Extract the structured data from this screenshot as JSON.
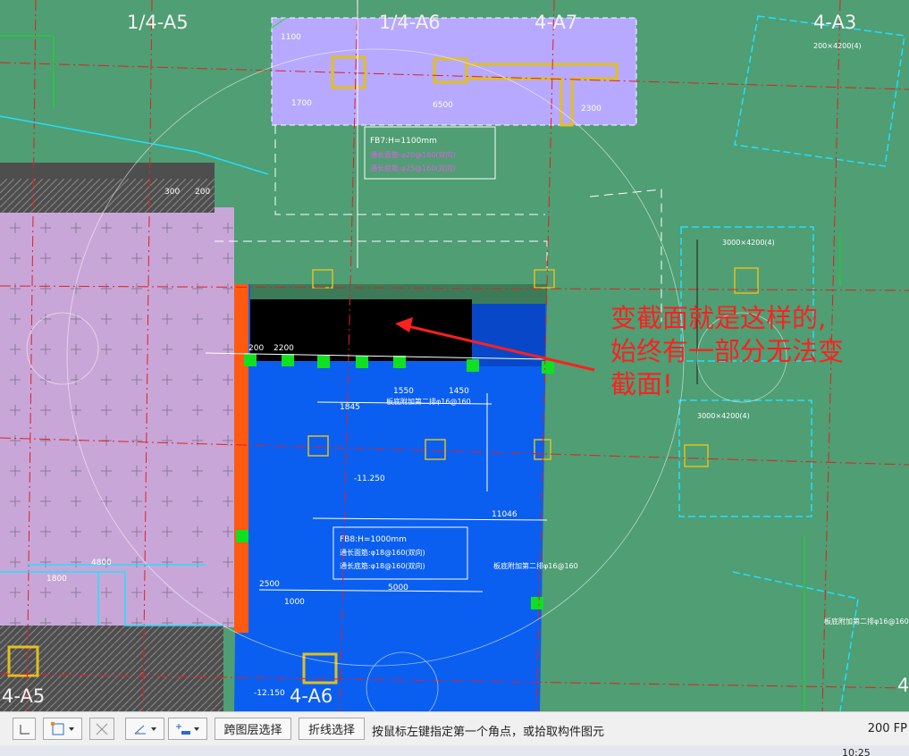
{
  "canvas": {
    "axis_labels": [
      "1/4-A5",
      "1/4-A6",
      "4-A7",
      "4-A3",
      "4-A5",
      "4-A6",
      "4"
    ],
    "cad_texts": {
      "beam_fb7": "FB7:H=1100mm",
      "fb7_line2": "通长面筋:φ20@160(双向)",
      "fb7_line3": "通长底筋:φ25@160(双向)",
      "beam_fb8": "FB8:H=1000mm",
      "fb8_line2": "通长面筋:φ18@160(双向)",
      "fb8_line3": "通长底筋:φ18@160(双向)",
      "dim_1550": "1550",
      "dim_1450": "1450",
      "dim_1845": "1845",
      "dim_11046": "11046",
      "dim_5000": "5000",
      "dim_2500": "2500",
      "dim_1000": "1000",
      "dim_4800": "4800",
      "dim_1800": "1800",
      "dim_200": "200",
      "dim_2200": "2200",
      "dim_1700": "1700",
      "dim_6500": "6500",
      "dim_2300": "2300",
      "dim_1100": "1100",
      "dim_300": "300",
      "dim_200b": "200",
      "elev_1": "-11.250",
      "elev_2": "-12.150",
      "slab_note_1": "板底附加第二排φ16@160",
      "slab_note_2": "板底附加第二排φ16@160",
      "slab_note_3": "板底附加第二排φ16@160",
      "pile_cap_1": "3000×4200(4)",
      "pile_cap_2": "3000×4200(4)",
      "pile_cap_3": "200×4200(4)"
    }
  },
  "annotation": {
    "line1": "变截面就是这样的,",
    "line2": "始终有一部分无法变",
    "line3": "截面!"
  },
  "toolbar": {
    "icon_select_names": [
      "ortho-icon",
      "rect-select-icon",
      "cancel-x-icon",
      "angle-icon",
      "align-icon"
    ],
    "cross_layer_select": "跨图层选择",
    "polyline_select": "折线选择",
    "prompt": "按鼠标左键指定第一个角点，或拾取构件图元",
    "zoom": "200 FP"
  },
  "taskbar": {
    "clock": "10:25"
  },
  "colors": {
    "background": "#4f9e74",
    "selected_slab": "#0a5ff0",
    "annotation_text": "#ff2020",
    "cad_cyan": "#20e0ff",
    "cad_red": "#e02020"
  }
}
